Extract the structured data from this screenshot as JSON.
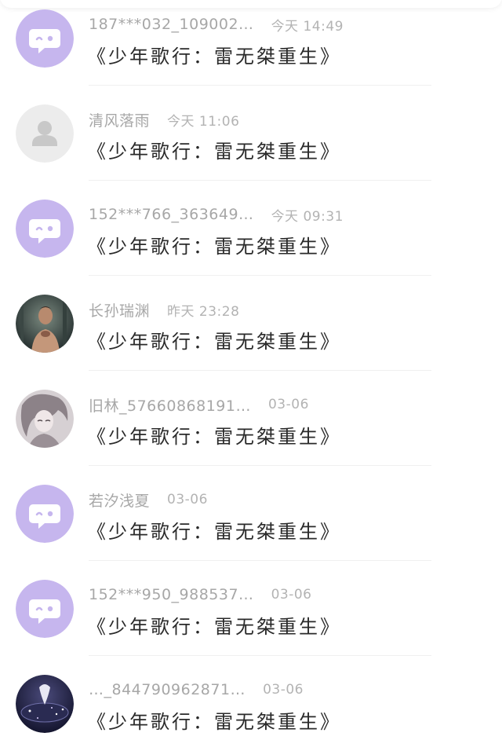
{
  "comments": [
    {
      "username": "187***032_109002…",
      "time": "今天 14:49",
      "content": "《少年歌行：雷无桀重生》",
      "avatar": "chat-bubble-icon",
      "avatar_color": "#c6b6ee"
    },
    {
      "username": "清风落雨",
      "time": "今天 11:06",
      "content": "《少年歌行：雷无桀重生》",
      "avatar": "default-user-icon",
      "avatar_color": "#ececec"
    },
    {
      "username": "152***766_363649…",
      "time": "今天 09:31",
      "content": "《少年歌行：雷无桀重生》",
      "avatar": "chat-bubble-icon",
      "avatar_color": "#c6b6ee"
    },
    {
      "username": "长孙瑞渊",
      "time": "昨天 23:28",
      "content": "《少年歌行：雷无桀重生》",
      "avatar": "photo-avatar",
      "avatar_color": "#3e4a47"
    },
    {
      "username": "旧林_57660868191…",
      "time": "03-06",
      "content": "《少年歌行：雷无桀重生》",
      "avatar": "anime-avatar",
      "avatar_color": "#b9b2b6"
    },
    {
      "username": "若汐浅夏",
      "time": "03-06",
      "content": "《少年歌行：雷无桀重生》",
      "avatar": "chat-bubble-icon",
      "avatar_color": "#c6b6ee"
    },
    {
      "username": "152***950_988537…",
      "time": "03-06",
      "content": "《少年歌行：雷无桀重生》",
      "avatar": "chat-bubble-icon",
      "avatar_color": "#c6b6ee"
    },
    {
      "username": "…_844790962871…",
      "time": "03-06",
      "content": "《少年歌行：雷无桀重生》",
      "avatar": "space-avatar",
      "avatar_color": "#1c1d3a"
    }
  ]
}
